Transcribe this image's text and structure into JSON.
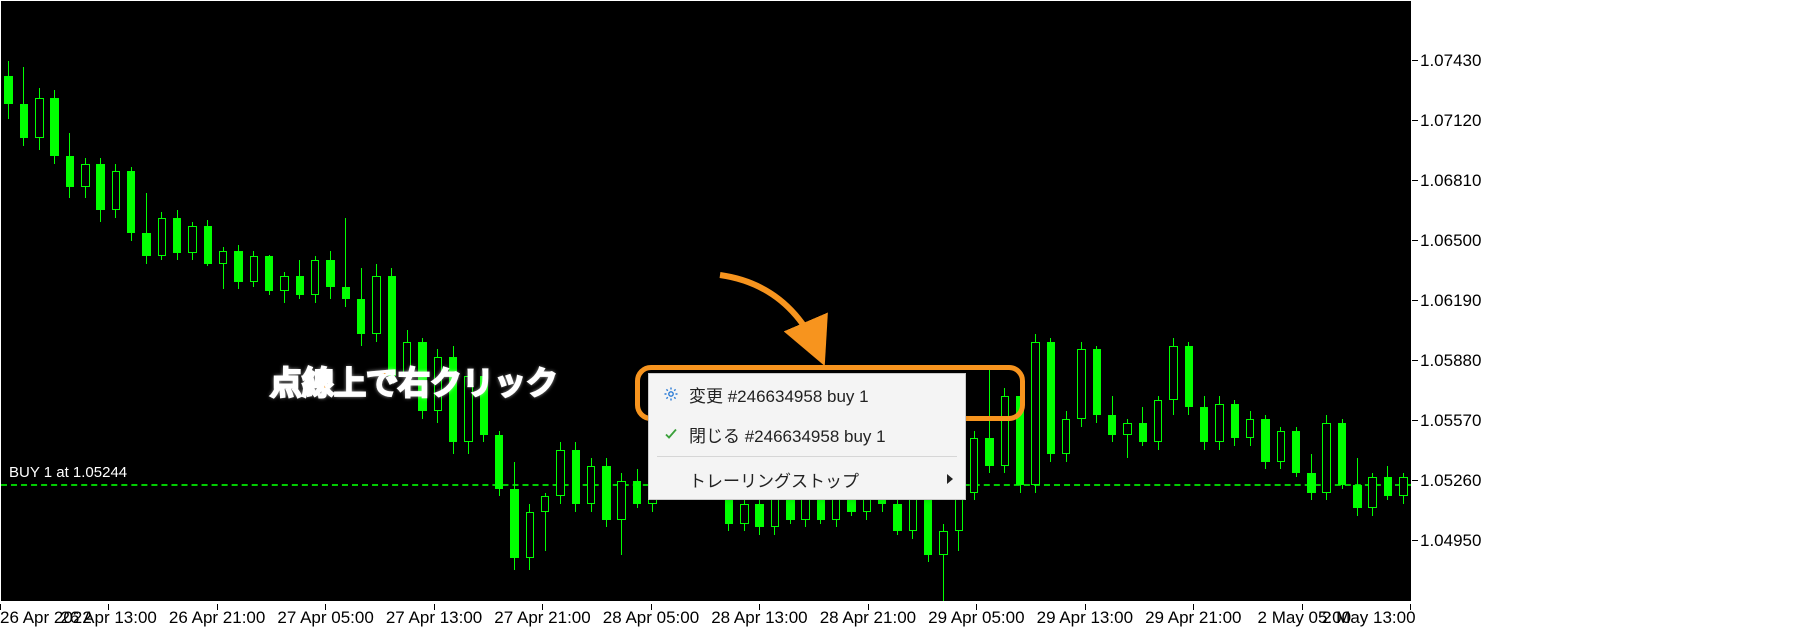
{
  "chart_data": {
    "type": "candlestick",
    "title": "",
    "xlabel": "",
    "ylabel": "",
    "ylim": [
      1.0464,
      1.0774
    ],
    "y_ticks": [
      1.0743,
      1.0712,
      1.0681,
      1.065,
      1.0619,
      1.0588,
      1.0557,
      1.0526,
      1.0495
    ],
    "x_ticks": [
      "26 Apr 2022",
      "26 Apr 13:00",
      "26 Apr 21:00",
      "27 Apr 05:00",
      "27 Apr 13:00",
      "27 Apr 21:00",
      "28 Apr 05:00",
      "28 Apr 13:00",
      "28 Apr 21:00",
      "29 Apr 05:00",
      "29 Apr 13:00",
      "29 Apr 21:00",
      "2 May 05:00",
      "2 May 13:00"
    ],
    "entry_line": {
      "price": 1.05244,
      "label": "BUY 1 at 1.05244"
    },
    "candles": [
      {
        "o": 1.0735,
        "h": 1.0743,
        "l": 1.0713,
        "c": 1.0721
      },
      {
        "o": 1.0721,
        "h": 1.074,
        "l": 1.0699,
        "c": 1.0703
      },
      {
        "o": 1.0703,
        "h": 1.0729,
        "l": 1.0697,
        "c": 1.0724
      },
      {
        "o": 1.0724,
        "h": 1.0728,
        "l": 1.069,
        "c": 1.0694
      },
      {
        "o": 1.0694,
        "h": 1.0706,
        "l": 1.0672,
        "c": 1.0678
      },
      {
        "o": 1.0678,
        "h": 1.0693,
        "l": 1.0672,
        "c": 1.069
      },
      {
        "o": 1.069,
        "h": 1.0693,
        "l": 1.066,
        "c": 1.0666
      },
      {
        "o": 1.0666,
        "h": 1.069,
        "l": 1.0662,
        "c": 1.0686
      },
      {
        "o": 1.0686,
        "h": 1.0688,
        "l": 1.065,
        "c": 1.0654
      },
      {
        "o": 1.0654,
        "h": 1.0675,
        "l": 1.0638,
        "c": 1.0642
      },
      {
        "o": 1.0642,
        "h": 1.0665,
        "l": 1.064,
        "c": 1.0662
      },
      {
        "o": 1.0662,
        "h": 1.0666,
        "l": 1.064,
        "c": 1.0644
      },
      {
        "o": 1.0644,
        "h": 1.066,
        "l": 1.064,
        "c": 1.0658
      },
      {
        "o": 1.0658,
        "h": 1.0661,
        "l": 1.0637,
        "c": 1.0638
      },
      {
        "o": 1.0638,
        "h": 1.0647,
        "l": 1.0625,
        "c": 1.0645
      },
      {
        "o": 1.0645,
        "h": 1.0648,
        "l": 1.0625,
        "c": 1.0629
      },
      {
        "o": 1.0629,
        "h": 1.0645,
        "l": 1.0626,
        "c": 1.0642
      },
      {
        "o": 1.0642,
        "h": 1.0643,
        "l": 1.0622,
        "c": 1.0624
      },
      {
        "o": 1.0624,
        "h": 1.0634,
        "l": 1.0618,
        "c": 1.0632
      },
      {
        "o": 1.0632,
        "h": 1.064,
        "l": 1.062,
        "c": 1.0622
      },
      {
        "o": 1.0622,
        "h": 1.0642,
        "l": 1.0618,
        "c": 1.064
      },
      {
        "o": 1.064,
        "h": 1.0645,
        "l": 1.062,
        "c": 1.0626
      },
      {
        "o": 1.0626,
        "h": 1.0662,
        "l": 1.0616,
        "c": 1.062
      },
      {
        "o": 1.062,
        "h": 1.0636,
        "l": 1.0596,
        "c": 1.0602
      },
      {
        "o": 1.0602,
        "h": 1.0638,
        "l": 1.0598,
        "c": 1.0632
      },
      {
        "o": 1.0632,
        "h": 1.0636,
        "l": 1.0576,
        "c": 1.058
      },
      {
        "o": 1.058,
        "h": 1.0604,
        "l": 1.057,
        "c": 1.0598
      },
      {
        "o": 1.0598,
        "h": 1.06,
        "l": 1.0558,
        "c": 1.0562
      },
      {
        "o": 1.0562,
        "h": 1.0594,
        "l": 1.0556,
        "c": 1.059
      },
      {
        "o": 1.059,
        "h": 1.0596,
        "l": 1.054,
        "c": 1.0546
      },
      {
        "o": 1.0546,
        "h": 1.0584,
        "l": 1.054,
        "c": 1.058
      },
      {
        "o": 1.058,
        "h": 1.0582,
        "l": 1.0546,
        "c": 1.055
      },
      {
        "o": 1.055,
        "h": 1.0552,
        "l": 1.0518,
        "c": 1.0522
      },
      {
        "o": 1.0522,
        "h": 1.0536,
        "l": 1.048,
        "c": 1.0486
      },
      {
        "o": 1.0486,
        "h": 1.0514,
        "l": 1.048,
        "c": 1.051
      },
      {
        "o": 1.051,
        "h": 1.052,
        "l": 1.049,
        "c": 1.0518
      },
      {
        "o": 1.0518,
        "h": 1.0546,
        "l": 1.0514,
        "c": 1.0542
      },
      {
        "o": 1.0542,
        "h": 1.0546,
        "l": 1.051,
        "c": 1.0514
      },
      {
        "o": 1.0514,
        "h": 1.0538,
        "l": 1.051,
        "c": 1.0534
      },
      {
        "o": 1.0534,
        "h": 1.0538,
        "l": 1.0502,
        "c": 1.0506
      },
      {
        "o": 1.0506,
        "h": 1.053,
        "l": 1.0488,
        "c": 1.0526
      },
      {
        "o": 1.0526,
        "h": 1.0532,
        "l": 1.0512,
        "c": 1.0514
      },
      {
        "o": 1.0514,
        "h": 1.054,
        "l": 1.051,
        "c": 1.0536
      },
      {
        "o": 1.0536,
        "h": 1.0556,
        "l": 1.0532,
        "c": 1.0552
      },
      {
        "o": 1.0552,
        "h": 1.0558,
        "l": 1.0536,
        "c": 1.054
      },
      {
        "o": 1.054,
        "h": 1.0544,
        "l": 1.0516,
        "c": 1.052
      },
      {
        "o": 1.052,
        "h": 1.0534,
        "l": 1.0516,
        "c": 1.0518
      },
      {
        "o": 1.0518,
        "h": 1.0522,
        "l": 1.05,
        "c": 1.0504
      },
      {
        "o": 1.0504,
        "h": 1.0516,
        "l": 1.05,
        "c": 1.0514
      },
      {
        "o": 1.0514,
        "h": 1.0516,
        "l": 1.0498,
        "c": 1.0502
      },
      {
        "o": 1.0502,
        "h": 1.052,
        "l": 1.0498,
        "c": 1.0518
      },
      {
        "o": 1.0518,
        "h": 1.052,
        "l": 1.0504,
        "c": 1.0506
      },
      {
        "o": 1.0506,
        "h": 1.0522,
        "l": 1.0502,
        "c": 1.052
      },
      {
        "o": 1.052,
        "h": 1.0522,
        "l": 1.0504,
        "c": 1.0506
      },
      {
        "o": 1.0506,
        "h": 1.052,
        "l": 1.0502,
        "c": 1.0518
      },
      {
        "o": 1.0518,
        "h": 1.0524,
        "l": 1.0508,
        "c": 1.051
      },
      {
        "o": 1.051,
        "h": 1.0528,
        "l": 1.0506,
        "c": 1.0524
      },
      {
        "o": 1.0524,
        "h": 1.0526,
        "l": 1.051,
        "c": 1.0514
      },
      {
        "o": 1.0514,
        "h": 1.0516,
        "l": 1.0498,
        "c": 1.05
      },
      {
        "o": 1.05,
        "h": 1.053,
        "l": 1.0496,
        "c": 1.0524
      },
      {
        "o": 1.0524,
        "h": 1.0528,
        "l": 1.0484,
        "c": 1.0488
      },
      {
        "o": 1.0488,
        "h": 1.0504,
        "l": 1.0464,
        "c": 1.05
      },
      {
        "o": 1.05,
        "h": 1.0524,
        "l": 1.049,
        "c": 1.052
      },
      {
        "o": 1.052,
        "h": 1.0552,
        "l": 1.0516,
        "c": 1.0548
      },
      {
        "o": 1.0548,
        "h": 1.0586,
        "l": 1.053,
        "c": 1.0534
      },
      {
        "o": 1.0534,
        "h": 1.0574,
        "l": 1.053,
        "c": 1.057
      },
      {
        "o": 1.057,
        "h": 1.0572,
        "l": 1.052,
        "c": 1.0524
      },
      {
        "o": 1.0524,
        "h": 1.0602,
        "l": 1.052,
        "c": 1.0598
      },
      {
        "o": 1.0598,
        "h": 1.06,
        "l": 1.0536,
        "c": 1.054
      },
      {
        "o": 1.054,
        "h": 1.0562,
        "l": 1.0536,
        "c": 1.0558
      },
      {
        "o": 1.0558,
        "h": 1.0598,
        "l": 1.0554,
        "c": 1.0594
      },
      {
        "o": 1.0594,
        "h": 1.0596,
        "l": 1.0556,
        "c": 1.056
      },
      {
        "o": 1.056,
        "h": 1.057,
        "l": 1.0546,
        "c": 1.055
      },
      {
        "o": 1.055,
        "h": 1.0558,
        "l": 1.0538,
        "c": 1.0556
      },
      {
        "o": 1.0556,
        "h": 1.0564,
        "l": 1.0544,
        "c": 1.0546
      },
      {
        "o": 1.0546,
        "h": 1.057,
        "l": 1.0542,
        "c": 1.0568
      },
      {
        "o": 1.0568,
        "h": 1.06,
        "l": 1.056,
        "c": 1.0596
      },
      {
        "o": 1.0596,
        "h": 1.0598,
        "l": 1.056,
        "c": 1.0564
      },
      {
        "o": 1.0564,
        "h": 1.057,
        "l": 1.0542,
        "c": 1.0546
      },
      {
        "o": 1.0546,
        "h": 1.057,
        "l": 1.0542,
        "c": 1.0566
      },
      {
        "o": 1.0566,
        "h": 1.0568,
        "l": 1.0544,
        "c": 1.0548
      },
      {
        "o": 1.0548,
        "h": 1.0562,
        "l": 1.0544,
        "c": 1.0558
      },
      {
        "o": 1.0558,
        "h": 1.056,
        "l": 1.0532,
        "c": 1.0536
      },
      {
        "o": 1.0536,
        "h": 1.0554,
        "l": 1.0532,
        "c": 1.0552
      },
      {
        "o": 1.0552,
        "h": 1.0554,
        "l": 1.0528,
        "c": 1.053
      },
      {
        "o": 1.053,
        "h": 1.054,
        "l": 1.0516,
        "c": 1.052
      },
      {
        "o": 1.052,
        "h": 1.056,
        "l": 1.0516,
        "c": 1.0556
      },
      {
        "o": 1.0556,
        "h": 1.0558,
        "l": 1.0522,
        "c": 1.0524
      },
      {
        "o": 1.0524,
        "h": 1.0538,
        "l": 1.0508,
        "c": 1.0512
      },
      {
        "o": 1.0512,
        "h": 1.053,
        "l": 1.0508,
        "c": 1.0528
      },
      {
        "o": 1.0528,
        "h": 1.0534,
        "l": 1.0516,
        "c": 1.0518
      },
      {
        "o": 1.0518,
        "h": 1.053,
        "l": 1.0514,
        "c": 1.0528
      }
    ]
  },
  "annotation": {
    "text": "点線上で右クリック"
  },
  "context_menu": {
    "items": [
      {
        "icon": "gear",
        "label": "変更 #246634958 buy 1",
        "highlighted": true
      },
      {
        "icon": "check",
        "label": "閉じる #246634958 buy 1"
      },
      {
        "icon": "",
        "label": "トレーリングストップ",
        "submenu": true
      }
    ]
  }
}
